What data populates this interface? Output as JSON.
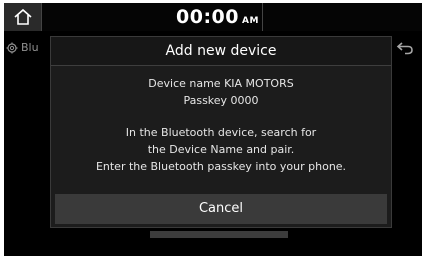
{
  "status_bar": {
    "time": "00:00",
    "ampm": "AM"
  },
  "background": {
    "title_partial": "Blu"
  },
  "dialog": {
    "title": "Add new device",
    "device_name_line": "Device name KIA MOTORS",
    "passkey_line": "Passkey 0000",
    "message_lines": [
      "In the Bluetooth device, search for",
      "the Device Name and pair.",
      "Enter the Bluetooth passkey into your phone."
    ],
    "cancel_label": "Cancel"
  },
  "icons": {
    "home": "home-icon",
    "settings": "gear-icon",
    "back": "back-arrow-icon"
  }
}
